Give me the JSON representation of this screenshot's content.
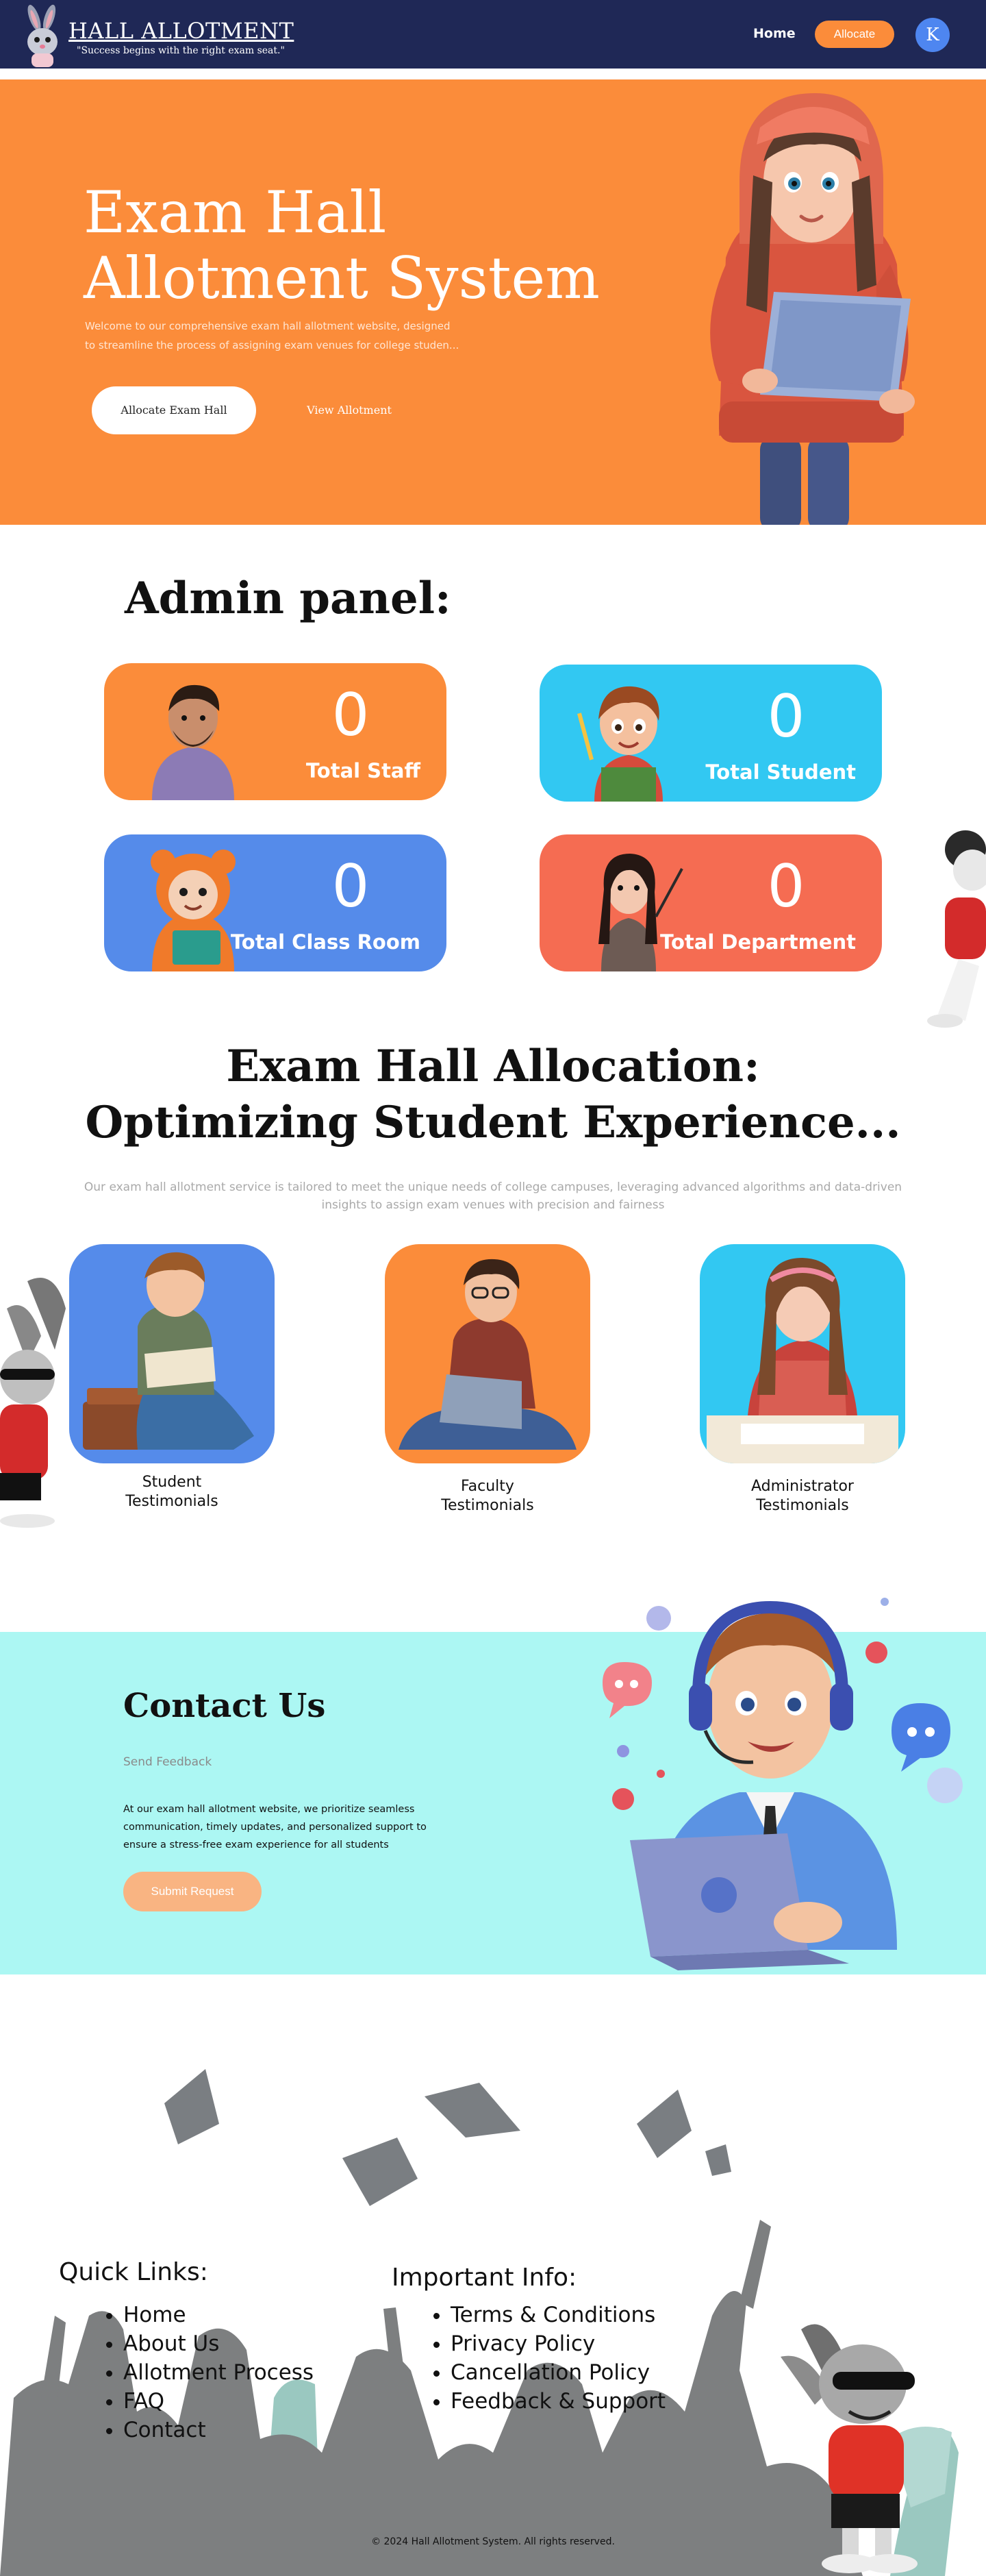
{
  "navbar": {
    "brand_title": "HALL ALLOTMENT",
    "brand_tagline": "\"Success begins with the right exam seat.\"",
    "home_label": "Home",
    "allocate_label": "Allocate",
    "avatar_letter": "K",
    "colors": {
      "bg": "#1f2856",
      "accent": "#fb8c3a",
      "avatar": "#4e86f0"
    }
  },
  "hero": {
    "title_line1": "Exam Hall",
    "title_line2": "Allotment System",
    "desc_line1": "Welcome to our comprehensive exam hall allotment website, designed",
    "desc_line2": "to streamline the process of assigning exam venues for college studen...",
    "btn_primary": "Allocate Exam Hall",
    "btn_secondary": "View Allotment",
    "bg_color": "#fb8c3a"
  },
  "admin": {
    "title": "Admin panel:",
    "cards": [
      {
        "value": "0",
        "label": "Total Staff",
        "color": "#fb8c3a",
        "icon": "staff-avatar-icon"
      },
      {
        "value": "0",
        "label": "Total Student",
        "color": "#32c8f2",
        "icon": "student-avatar-icon"
      },
      {
        "value": "0",
        "label": "Total Class Room",
        "color": "#558bea",
        "icon": "classroom-avatar-icon"
      },
      {
        "value": "0",
        "label": "Total Department",
        "color": "#f56c52",
        "icon": "department-avatar-icon"
      }
    ]
  },
  "allocation": {
    "title_line1": "Exam Hall Allocation:",
    "title_line2": "Optimizing Student Experience...",
    "subtitle": "Our exam hall allotment service is tailored to meet the unique needs of college campuses, leveraging advanced algorithms and data-driven insights to assign exam venues with precision and fairness",
    "testimonials": [
      {
        "line1": "Student",
        "line2": "Testimonials",
        "color": "#558bea"
      },
      {
        "line1": "Faculty",
        "line2": "Testimonials",
        "color": "#fb8c3a"
      },
      {
        "line1": "Administrator",
        "line2": "Testimonials",
        "color": "#32c8f2"
      }
    ]
  },
  "contact": {
    "title": "Contact Us",
    "subtitle": "Send Feedback",
    "description": "At our exam hall allotment website, we prioritize seamless communication, timely updates, and personalized support to ensure a stress-free exam experience for all students",
    "button": "Submit Request",
    "bg_color": "#acf7f3"
  },
  "footer": {
    "quick_links_title": "Quick Links:",
    "quick_links": [
      "Home",
      "About Us",
      "Allotment Process",
      "FAQ",
      "Contact"
    ],
    "important_info_title": "Important Info:",
    "important_info": [
      "Terms & Conditions",
      "Privacy Policy",
      "Cancellation Policy",
      "Feedback & Support"
    ],
    "copyright": "© 2024 Hall Allotment System. All rights reserved."
  }
}
